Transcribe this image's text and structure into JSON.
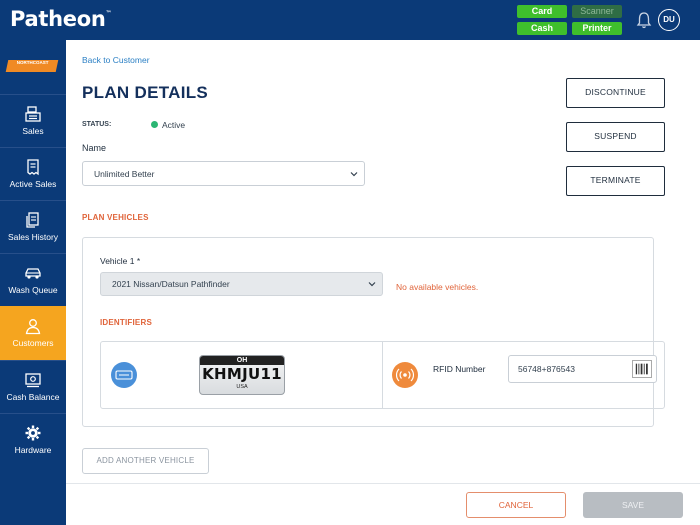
{
  "app": {
    "logo": "Patheon",
    "trademark": "™"
  },
  "header": {
    "pills": [
      {
        "label": "Card",
        "state": "connected"
      },
      {
        "label": "Scanner",
        "state": "disconnected"
      },
      {
        "label": "Cash",
        "state": "connected"
      },
      {
        "label": "Printer",
        "state": "connected"
      }
    ],
    "user_initials": "DU",
    "colors": {
      "bar": "#0b3a78",
      "pill_green": "#3fbf2c"
    }
  },
  "sidebar": {
    "site_badge": "NORTHCOAST",
    "items": [
      {
        "label": "Sales",
        "icon": "register-icon"
      },
      {
        "label": "Active Sales",
        "icon": "receipt-icon"
      },
      {
        "label": "Sales History",
        "icon": "history-icon"
      },
      {
        "label": "Wash Queue",
        "icon": "car-icon"
      },
      {
        "label": "Customers",
        "icon": "user-icon",
        "active": true
      },
      {
        "label": "Cash Balance",
        "icon": "cash-icon"
      },
      {
        "label": "Hardware",
        "icon": "gear-icon"
      }
    ],
    "active_color": "#f5a51f"
  },
  "main": {
    "back_link": "Back to Customer",
    "title": "PLAN DETAILS",
    "status_label": "STATUS:",
    "status_value": "Active",
    "status_color": "#2bb673",
    "name_label": "Name",
    "name_value": "Unlimited Better",
    "actions": {
      "discontinue": "DISCONTINUE",
      "suspend": "SUSPEND",
      "terminate": "TERMINATE"
    },
    "plan_vehicles_header": "PLAN VEHICLES",
    "vehicle": {
      "label": "Vehicle 1 *",
      "selected": "2021 Nissan/Datsun Pathfinder",
      "warning": "No available vehicles.",
      "identifiers_header": "IDENTIFIERS",
      "plate": {
        "state": "OH",
        "number": "KHMJU11",
        "country": "USA"
      },
      "rfid_label": "RFID Number",
      "rfid_value": "56748+876543"
    },
    "add_vehicle": "ADD ANOTHER VEHICLE",
    "footer": {
      "cancel": "CANCEL",
      "save": "SAVE"
    },
    "accent_color": "#e0643a"
  }
}
